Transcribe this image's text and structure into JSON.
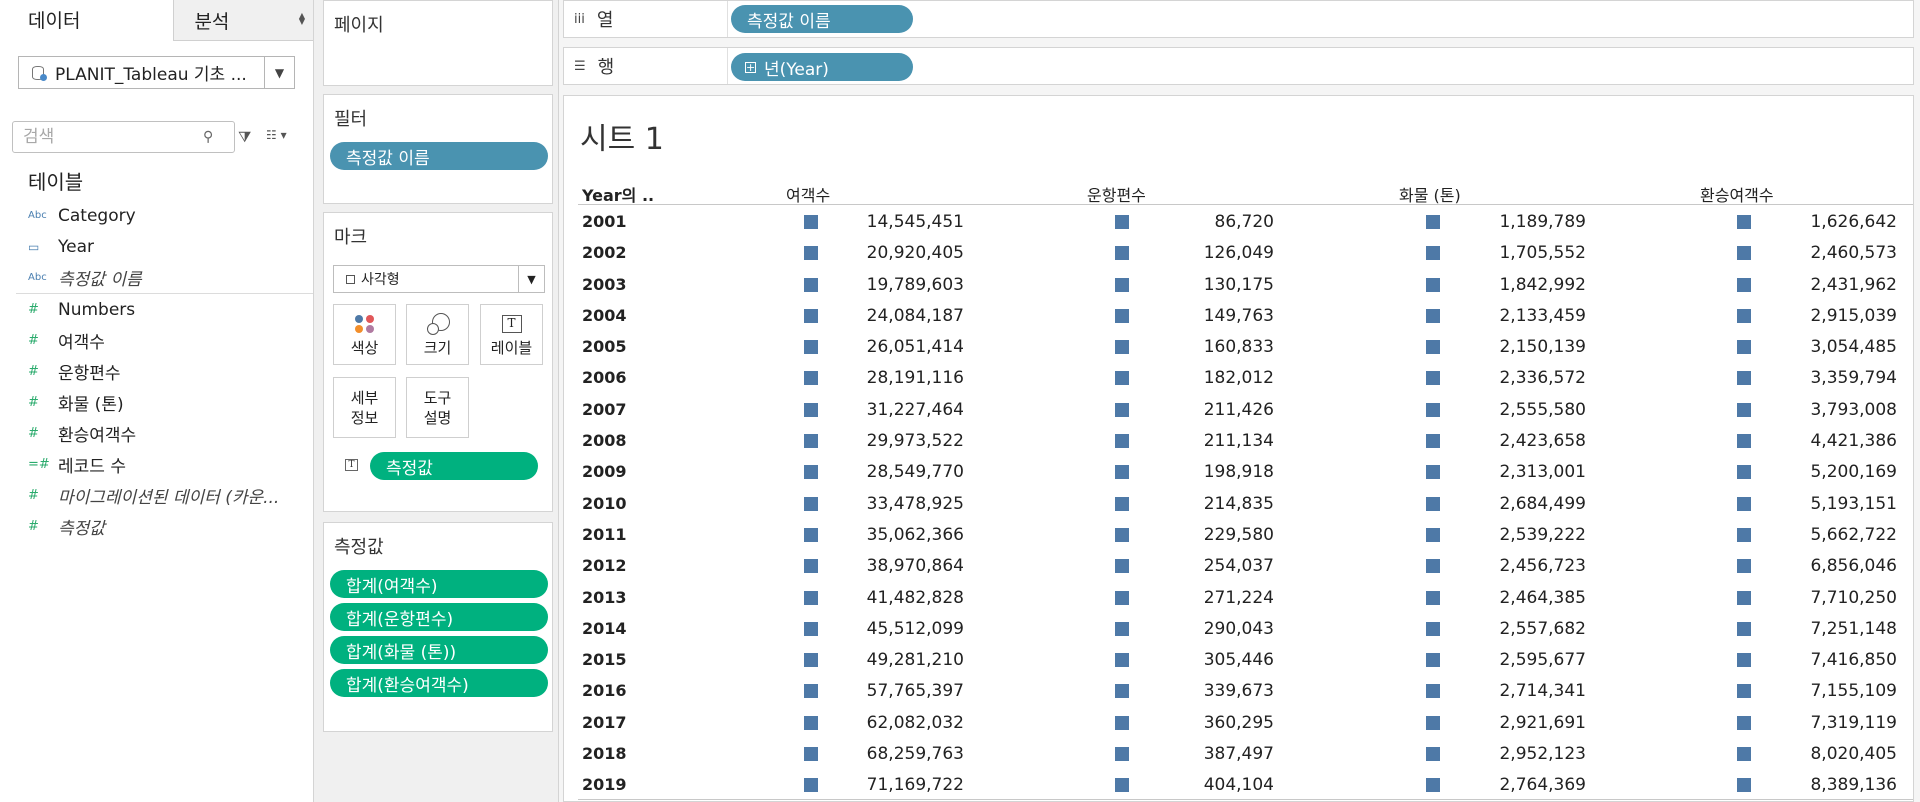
{
  "tabs": {
    "data": "데이터",
    "analysis": "분석"
  },
  "datasource": {
    "name": "PLANIT_Tableau 기초 ..."
  },
  "search": {
    "placeholder": "검색"
  },
  "table_section": {
    "title": "테이블"
  },
  "fields": [
    {
      "label": "Category",
      "type": "Abc",
      "italic": false
    },
    {
      "label": "Year",
      "type": "date",
      "italic": false
    },
    {
      "label": "측정값 이름",
      "type": "Abc",
      "italic": true
    },
    {
      "label": "Numbers",
      "type": "#",
      "italic": false
    },
    {
      "label": "여객수",
      "type": "#",
      "italic": false
    },
    {
      "label": "운항편수",
      "type": "#",
      "italic": false
    },
    {
      "label": "화물 (톤)",
      "type": "#",
      "italic": false
    },
    {
      "label": "환승여객수",
      "type": "#",
      "italic": false
    },
    {
      "label": "레코드 수",
      "type": "=#",
      "italic": false
    },
    {
      "label": "마이그레이션된 데이터 (카운...",
      "type": "#",
      "italic": true
    },
    {
      "label": "측정값",
      "type": "#",
      "italic": true
    }
  ],
  "pages_card": {
    "title": "페이지"
  },
  "filters_card": {
    "title": "필터",
    "pill": "측정값 이름"
  },
  "marks_card": {
    "title": "마크",
    "mark_type": "사각형",
    "buttons": {
      "color": "색상",
      "size": "크기",
      "label": "레이블",
      "detail_1": "세부",
      "detail_2": "정보",
      "tooltip_1": "도구",
      "tooltip_2": "설명"
    },
    "text_pill": "측정값"
  },
  "measures_card": {
    "title": "측정값",
    "pills": [
      "합계(여객수)",
      "합계(운항편수)",
      "합계(화물 (톤))",
      "합계(환승여객수)"
    ]
  },
  "shelves": {
    "columns": {
      "label": "열",
      "pill": "측정값 이름"
    },
    "rows": {
      "label": "행",
      "pill": "년(Year)"
    }
  },
  "sheet": {
    "title": "시트 1",
    "headers": [
      "Year의 ..",
      "여객수",
      "운항편수",
      "화물 (톤)",
      "환승여객수"
    ],
    "rows": [
      [
        "2001",
        "14,545,451",
        "86,720",
        "1,189,789",
        "1,626,642"
      ],
      [
        "2002",
        "20,920,405",
        "126,049",
        "1,705,552",
        "2,460,573"
      ],
      [
        "2003",
        "19,789,603",
        "130,175",
        "1,842,992",
        "2,431,962"
      ],
      [
        "2004",
        "24,084,187",
        "149,763",
        "2,133,459",
        "2,915,039"
      ],
      [
        "2005",
        "26,051,414",
        "160,833",
        "2,150,139",
        "3,054,485"
      ],
      [
        "2006",
        "28,191,116",
        "182,012",
        "2,336,572",
        "3,359,794"
      ],
      [
        "2007",
        "31,227,464",
        "211,426",
        "2,555,580",
        "3,793,008"
      ],
      [
        "2008",
        "29,973,522",
        "211,134",
        "2,423,658",
        "4,421,386"
      ],
      [
        "2009",
        "28,549,770",
        "198,918",
        "2,313,001",
        "5,200,169"
      ],
      [
        "2010",
        "33,478,925",
        "214,835",
        "2,684,499",
        "5,193,151"
      ],
      [
        "2011",
        "35,062,366",
        "229,580",
        "2,539,222",
        "5,662,722"
      ],
      [
        "2012",
        "38,970,864",
        "254,037",
        "2,456,723",
        "6,856,046"
      ],
      [
        "2013",
        "41,482,828",
        "271,224",
        "2,464,385",
        "7,710,250"
      ],
      [
        "2014",
        "45,512,099",
        "290,043",
        "2,557,682",
        "7,251,148"
      ],
      [
        "2015",
        "49,281,210",
        "305,446",
        "2,595,677",
        "7,416,850"
      ],
      [
        "2016",
        "57,765,397",
        "339,673",
        "2,714,341",
        "7,155,109"
      ],
      [
        "2017",
        "62,082,032",
        "360,295",
        "2,921,691",
        "7,319,119"
      ],
      [
        "2018",
        "68,259,763",
        "387,497",
        "2,952,123",
        "8,020,405"
      ],
      [
        "2019",
        "71,169,722",
        "404,104",
        "2,764,369",
        "8,389,136"
      ]
    ]
  },
  "colors": {
    "mark": "#4e79a7",
    "dimension_pill": "#4a93b0",
    "measure_pill": "#00b17f"
  }
}
